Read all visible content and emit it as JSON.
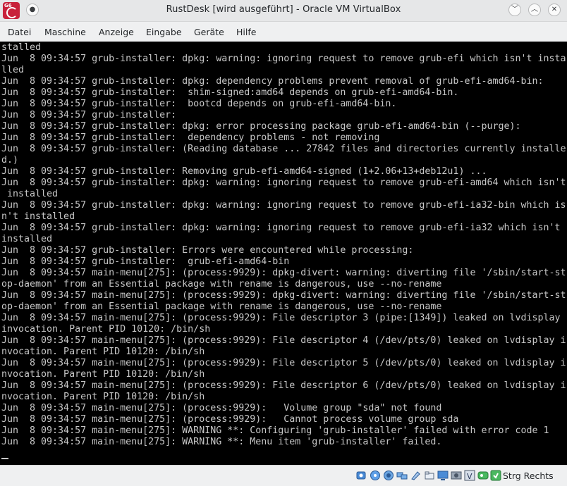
{
  "window": {
    "title": "RustDesk [wird ausgeführt] - Oracle VM VirtualBox"
  },
  "menu": [
    "Datei",
    "Maschine",
    "Anzeige",
    "Eingabe",
    "Geräte",
    "Hilfe"
  ],
  "console": {
    "lines": [
      "stalled",
      "Jun  8 09:34:57 grub-installer: dpkg: warning: ignoring request to remove grub-efi which isn't insta",
      "lled",
      "Jun  8 09:34:57 grub-installer: dpkg: dependency problems prevent removal of grub-efi-amd64-bin:",
      "Jun  8 09:34:57 grub-installer:  shim-signed:amd64 depends on grub-efi-amd64-bin.",
      "Jun  8 09:34:57 grub-installer:  bootcd depends on grub-efi-amd64-bin.",
      "Jun  8 09:34:57 grub-installer:",
      "Jun  8 09:34:57 grub-installer: dpkg: error processing package grub-efi-amd64-bin (--purge):",
      "Jun  8 09:34:57 grub-installer:  dependency problems - not removing",
      "Jun  8 09:34:57 grub-installer: (Reading database ... 27842 files and directories currently installe",
      "d.)",
      "Jun  8 09:34:57 grub-installer: Removing grub-efi-amd64-signed (1+2.06+13+deb12u1) ...",
      "Jun  8 09:34:57 grub-installer: dpkg: warning: ignoring request to remove grub-efi-amd64 which isn't",
      " installed",
      "Jun  8 09:34:57 grub-installer: dpkg: warning: ignoring request to remove grub-efi-ia32-bin which is",
      "n't installed",
      "Jun  8 09:34:57 grub-installer: dpkg: warning: ignoring request to remove grub-efi-ia32 which isn't",
      "installed",
      "Jun  8 09:34:57 grub-installer: Errors were encountered while processing:",
      "Jun  8 09:34:57 grub-installer:  grub-efi-amd64-bin",
      "Jun  8 09:34:57 main-menu[275]: (process:9929): dpkg-divert: warning: diverting file '/sbin/start-st",
      "op-daemon' from an Essential package with rename is dangerous, use --no-rename",
      "Jun  8 09:34:57 main-menu[275]: (process:9929): dpkg-divert: warning: diverting file '/sbin/start-st",
      "op-daemon' from an Essential package with rename is dangerous, use --no-rename",
      "Jun  8 09:34:57 main-menu[275]: (process:9929): File descriptor 3 (pipe:[1349]) leaked on lvdisplay",
      "invocation. Parent PID 10120: /bin/sh",
      "Jun  8 09:34:57 main-menu[275]: (process:9929): File descriptor 4 (/dev/pts/0) leaked on lvdisplay i",
      "nvocation. Parent PID 10120: /bin/sh",
      "Jun  8 09:34:57 main-menu[275]: (process:9929): File descriptor 5 (/dev/pts/0) leaked on lvdisplay i",
      "nvocation. Parent PID 10120: /bin/sh",
      "Jun  8 09:34:57 main-menu[275]: (process:9929): File descriptor 6 (/dev/pts/0) leaked on lvdisplay i",
      "nvocation. Parent PID 10120: /bin/sh",
      "Jun  8 09:34:57 main-menu[275]: (process:9929):   Volume group \"sda\" not found",
      "Jun  8 09:34:57 main-menu[275]: (process:9929):   Cannot process volume group sda",
      "Jun  8 09:34:57 main-menu[275]: WARNING **: Configuring 'grub-installer' failed with error code 1",
      "Jun  8 09:34:57 main-menu[275]: WARNING **: Menu item 'grub-installer' failed."
    ]
  },
  "statusbar": {
    "host_key": "Strg Rechts",
    "icons": [
      "hard-disk-icon",
      "optical-drive-icon",
      "audio-icon",
      "network-icon",
      "usb-icon",
      "shared-folders-icon",
      "display-icon",
      "video-capture-icon",
      "guest-additions-icon",
      "cpu-icon",
      "mouse-integration-icon",
      "keyboard-capture-icon"
    ]
  },
  "colors": {
    "console_bg": "#000000",
    "console_text": "#c7c7c7",
    "app_icon": "#c8213a",
    "window_bg": "#eff0f1"
  }
}
